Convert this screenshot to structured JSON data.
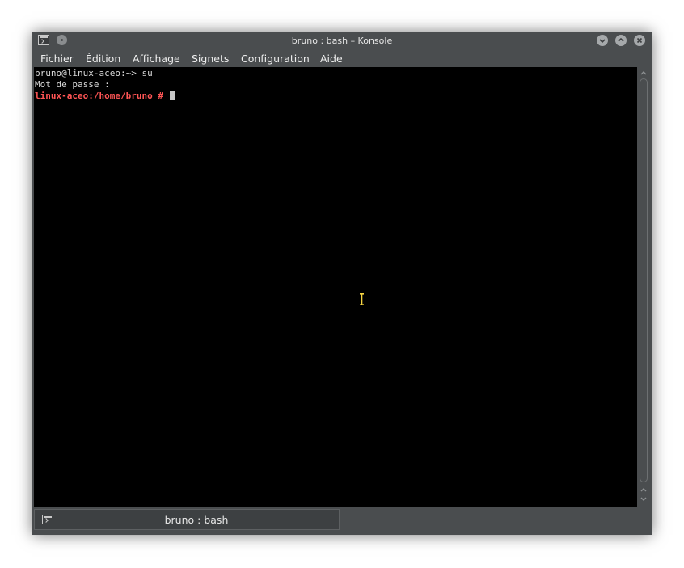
{
  "window": {
    "title": "bruno : bash – Konsole"
  },
  "menubar": {
    "items": [
      "Fichier",
      "Édition",
      "Affichage",
      "Signets",
      "Configuration",
      "Aide"
    ]
  },
  "terminal": {
    "lines": [
      {
        "text": "bruno@linux-aceo:~> su",
        "style": "normal"
      },
      {
        "text": "Mot de passe :",
        "style": "normal"
      },
      {
        "text": "linux-aceo:/home/bruno # ",
        "style": "root"
      }
    ],
    "colors": {
      "background": "#000000",
      "foreground": "#d8d8d8",
      "root_prompt": "#ff5555",
      "mouse_cursor": "#f5d442"
    }
  },
  "tabs": [
    {
      "label": "bruno : bash",
      "active": true
    }
  ],
  "icons": {
    "app": "terminal-icon",
    "menu": "window-menu-icon",
    "minimize": "chevron-down-icon",
    "maximize": "chevron-up-icon",
    "close": "close-icon",
    "tab": "terminal-icon"
  }
}
